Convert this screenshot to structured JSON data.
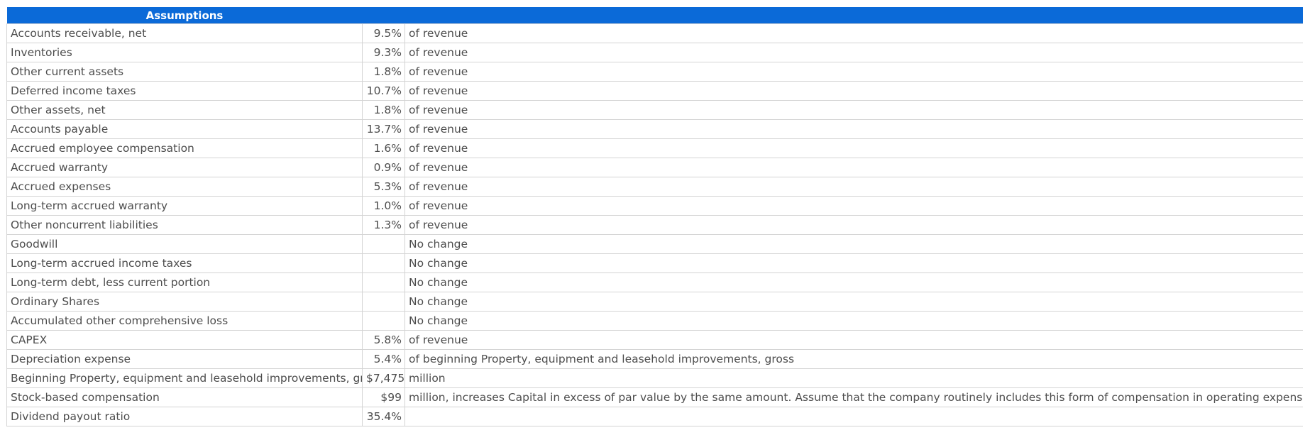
{
  "title": "Assumptions",
  "rows": [
    {
      "label": "Accounts receivable, net",
      "value": "9.5%",
      "note": "of revenue"
    },
    {
      "label": "Inventories",
      "value": "9.3%",
      "note": "of revenue"
    },
    {
      "label": "Other current assets",
      "value": "1.8%",
      "note": "of revenue"
    },
    {
      "label": "Deferred income taxes",
      "value": "10.7%",
      "note": "of revenue"
    },
    {
      "label": "Other assets, net",
      "value": "1.8%",
      "note": "of revenue"
    },
    {
      "label": "Accounts payable",
      "value": "13.7%",
      "note": "of revenue"
    },
    {
      "label": "Accrued employee compensation",
      "value": "1.6%",
      "note": "of revenue"
    },
    {
      "label": "Accrued warranty",
      "value": "0.9%",
      "note": "of revenue"
    },
    {
      "label": "Accrued expenses",
      "value": "5.3%",
      "note": "of revenue"
    },
    {
      "label": "Long-term accrued warranty",
      "value": "1.0%",
      "note": "of revenue"
    },
    {
      "label": "Other noncurrent liabilities",
      "value": "1.3%",
      "note": "of revenue"
    },
    {
      "label": "Goodwill",
      "value": "",
      "note": "No change"
    },
    {
      "label": "Long-term accrued income taxes",
      "value": "",
      "note": "No change"
    },
    {
      "label": "Long-term debt, less current portion",
      "value": "",
      "note": "No change"
    },
    {
      "label": "Ordinary Shares",
      "value": "",
      "note": "No change"
    },
    {
      "label": "Accumulated other comprehensive loss",
      "value": "",
      "note": "No change"
    },
    {
      "label": "CAPEX",
      "value": "5.8%",
      "note": "of revenue"
    },
    {
      "label": "Depreciation expense",
      "value": "5.4%",
      "note": "of beginning Property, equipment and leasehold improvements, gross"
    },
    {
      "label": "Beginning Property, equipment and leasehold improvements, gross",
      "value": "$7,475",
      "note": "million"
    },
    {
      "label": "Stock-based compensation",
      "value": "$99",
      "note": "million, increases Capital in excess of par value by the same amount. Assume that the company routinely includes this form of compensation in operating expenses each year"
    },
    {
      "label": "Dividend payout ratio",
      "value": "35.4%",
      "note": ""
    }
  ]
}
